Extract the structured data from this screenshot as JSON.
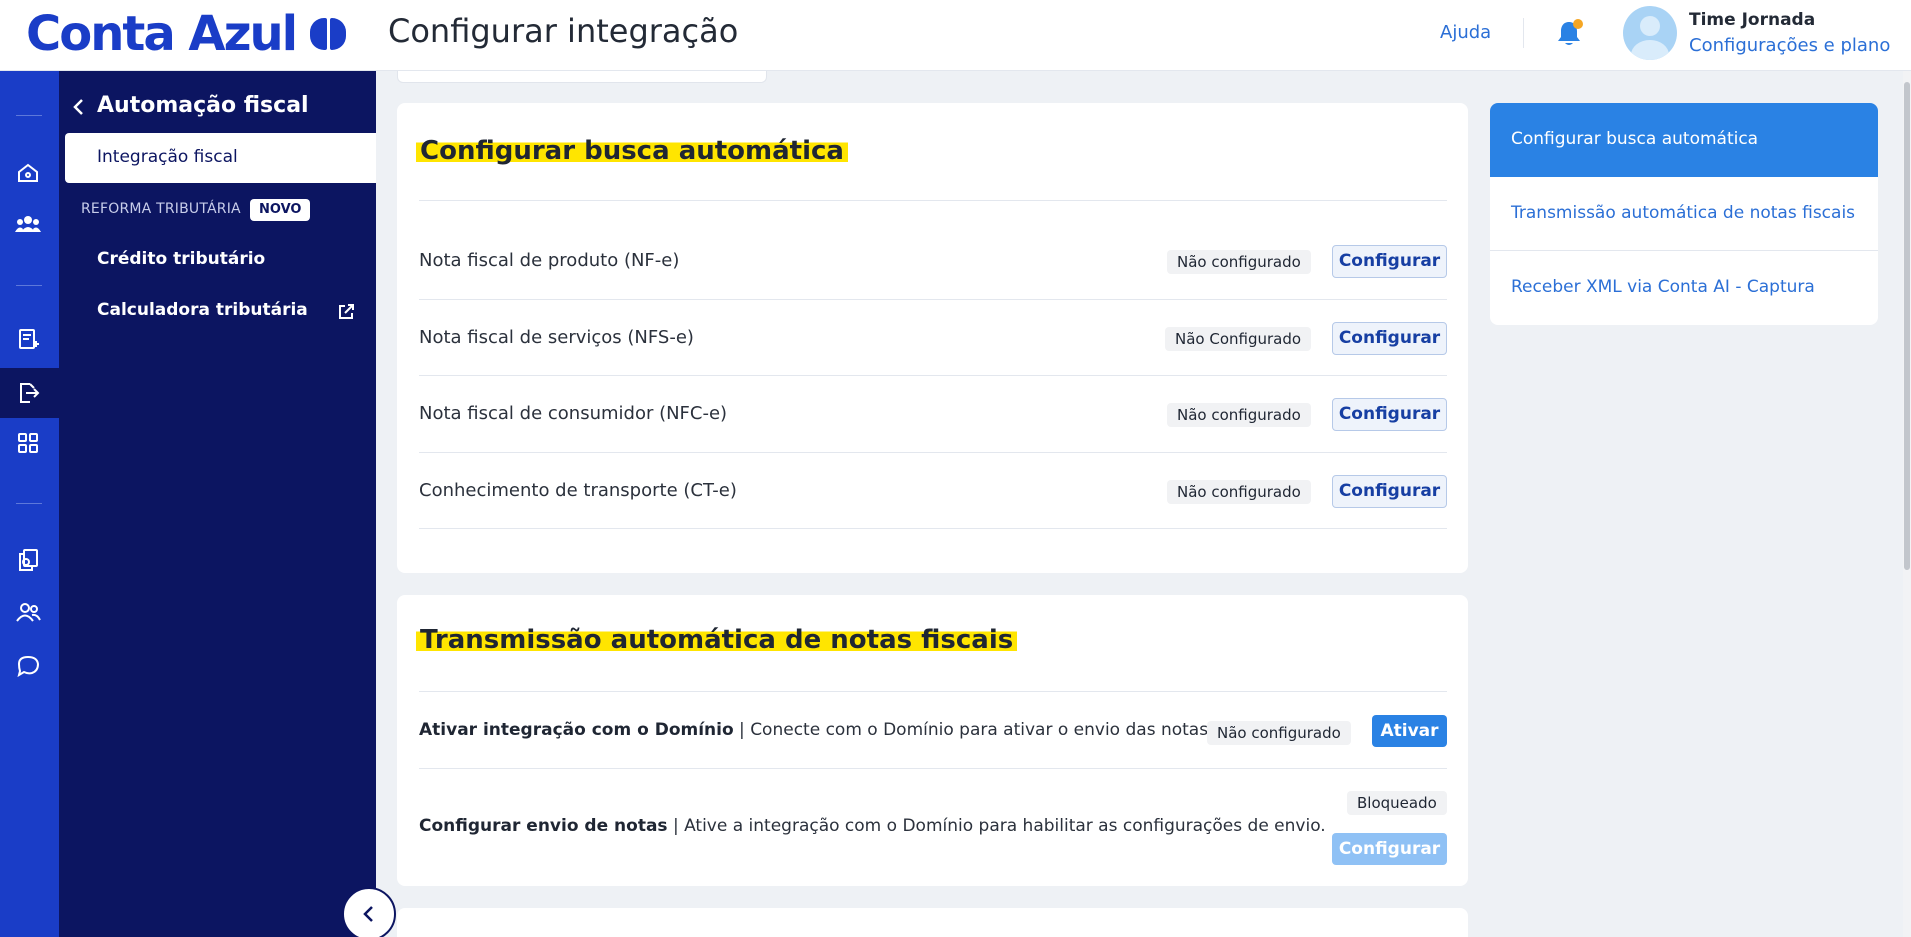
{
  "header": {
    "logo_text": "Conta Azul",
    "page_title": "Configurar integração",
    "help_label": "Ajuda",
    "user_name": "Time Jornada",
    "user_link": "Configurações e plano",
    "notification_dot_color": "#f5a623"
  },
  "rail": {
    "icons": [
      "home-icon",
      "users-icon",
      "invoice-icon",
      "export-icon",
      "apps-icon",
      "documents-icon",
      "contacts-icon",
      "chat-icon"
    ],
    "active": "export-icon"
  },
  "subnav": {
    "title": "Automação fiscal",
    "active_item": "Integração fiscal",
    "section_label": "REFORMA TRIBUTÁRIA",
    "section_badge": "NOVO",
    "items": [
      "Crédito tributário",
      "Calculadora tributária"
    ]
  },
  "busca": {
    "title": "Configurar busca automática",
    "rows": [
      {
        "label": "Nota fiscal de produto (NF-e)",
        "status": "Não configurado",
        "action": "Configurar"
      },
      {
        "label": "Nota fiscal de serviços (NFS-e)",
        "status": "Não Configurado",
        "action": "Configurar"
      },
      {
        "label": "Nota fiscal de consumidor (NFC-e)",
        "status": "Não configurado",
        "action": "Configurar"
      },
      {
        "label": "Conhecimento de transporte (CT-e)",
        "status": "Não configurado",
        "action": "Configurar"
      }
    ]
  },
  "transmissao": {
    "title": "Transmissão automática de notas fiscais",
    "rows": [
      {
        "bold": "Ativar integração com o Domínio",
        "text": " | Conecte com o Domínio para ativar o envio das notas.",
        "status": "Não configurado",
        "action": "Ativar"
      },
      {
        "bold": "Configurar envio de notas",
        "text": " | Ative a integração com o Domínio para habilitar as configurações de envio.",
        "status": "Bloqueado",
        "action": "Configurar"
      }
    ]
  },
  "anchors": {
    "active": "Configurar busca automática",
    "items": [
      "Transmissão automática de notas fiscais",
      "Receber XML via Conta AI - Captura"
    ]
  },
  "colors": {
    "brand": "#1a3dc7",
    "sidebar": "#0c1561",
    "accent": "#2a82e4",
    "highlight": "#ffe500"
  }
}
